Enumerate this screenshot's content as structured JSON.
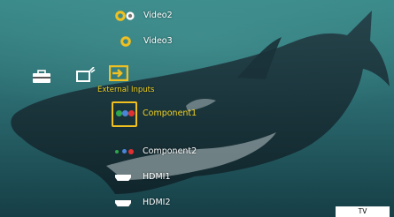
{
  "inputs": {
    "video2": "Video2",
    "video3": "Video3",
    "component1": "Component1",
    "component2": "Component2",
    "hdmi1": "HDMI1",
    "hdmi2": "HDMI2"
  },
  "category": {
    "selected_label": "External Inputs",
    "icons": [
      "toolbox-icon",
      "tv-settings-icon",
      "external-input-icon"
    ]
  },
  "status": {
    "mode": "TV"
  },
  "colors": {
    "highlight": "#f0c020",
    "label": "#ffffff",
    "background": "#1f4d54"
  }
}
